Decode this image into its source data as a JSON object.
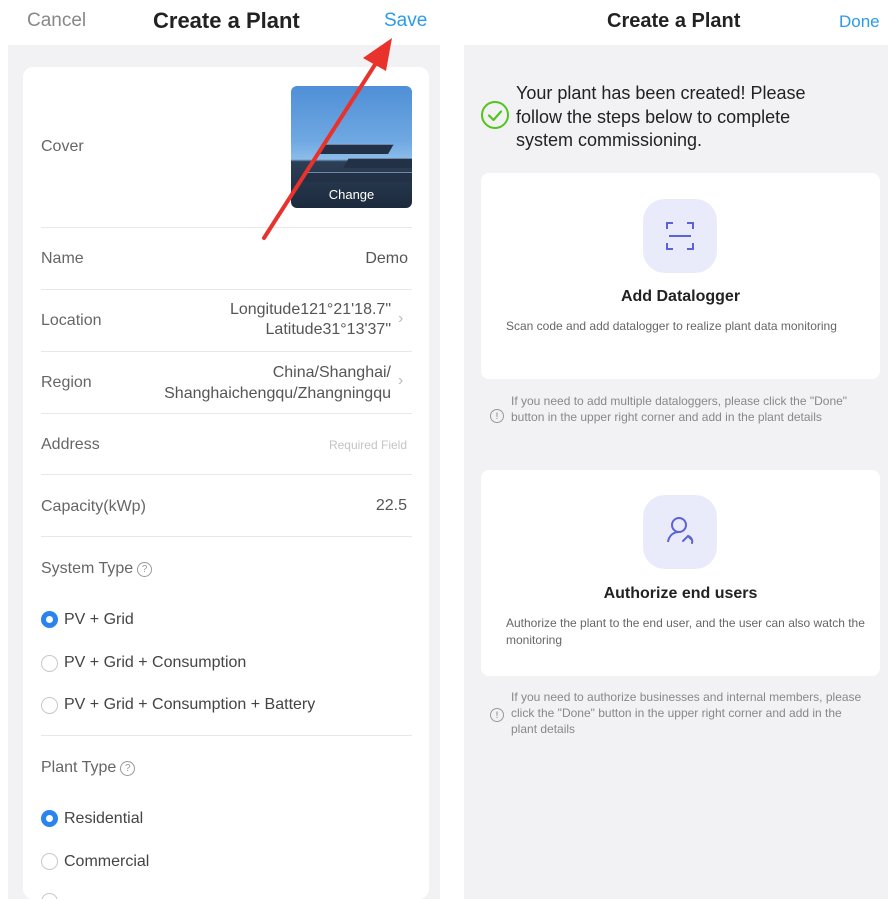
{
  "left": {
    "header": {
      "cancel": "Cancel",
      "title": "Create a Plant",
      "save": "Save"
    },
    "cover": {
      "label": "Cover",
      "change": "Change"
    },
    "name": {
      "label": "Name",
      "value": "Demo"
    },
    "location": {
      "label": "Location",
      "line1": "Longitude121°21'18.7\"",
      "line2": "Latitude31°13'37\""
    },
    "region": {
      "label": "Region",
      "line1": "China/Shanghai/",
      "line2": "Shanghaichengqu/Zhangningqu"
    },
    "address": {
      "label": "Address",
      "placeholder": "Required Field"
    },
    "capacity": {
      "label": "Capacity(kWp)",
      "value": "22.5"
    },
    "system_type": {
      "label": "System Type",
      "options": [
        "PV + Grid",
        "PV + Grid + Consumption",
        "PV + Grid + Consumption + Battery"
      ],
      "selected": "PV + Grid"
    },
    "plant_type": {
      "label": "Plant Type",
      "options": [
        "Residential",
        "Commercial"
      ],
      "selected": "Residential"
    }
  },
  "right": {
    "header": {
      "title": "Create a Plant",
      "done": "Done"
    },
    "success_message": "Your plant has been created! Please follow the steps below to complete system commissioning.",
    "steps": [
      {
        "title": "Add Datalogger",
        "desc": "Scan code and add datalogger to realize plant data monitoring",
        "icon": "scan-icon"
      },
      {
        "title": "Authorize end users",
        "desc": "Authorize the plant to the end user, and the user can also watch the monitoring",
        "icon": "user-share-icon"
      }
    ],
    "notes": [
      "If you need to add multiple dataloggers, please click the \"Done\" button in the upper right corner and add in the plant details",
      "If you need to authorize businesses and internal members, please click the \"Done\" button in the upper right corner and add in the plant details"
    ]
  },
  "colors": {
    "accent": "#2a84f0",
    "link": "#2a9ce8",
    "success": "#52c41a",
    "annotation_arrow": "#e8322b"
  }
}
